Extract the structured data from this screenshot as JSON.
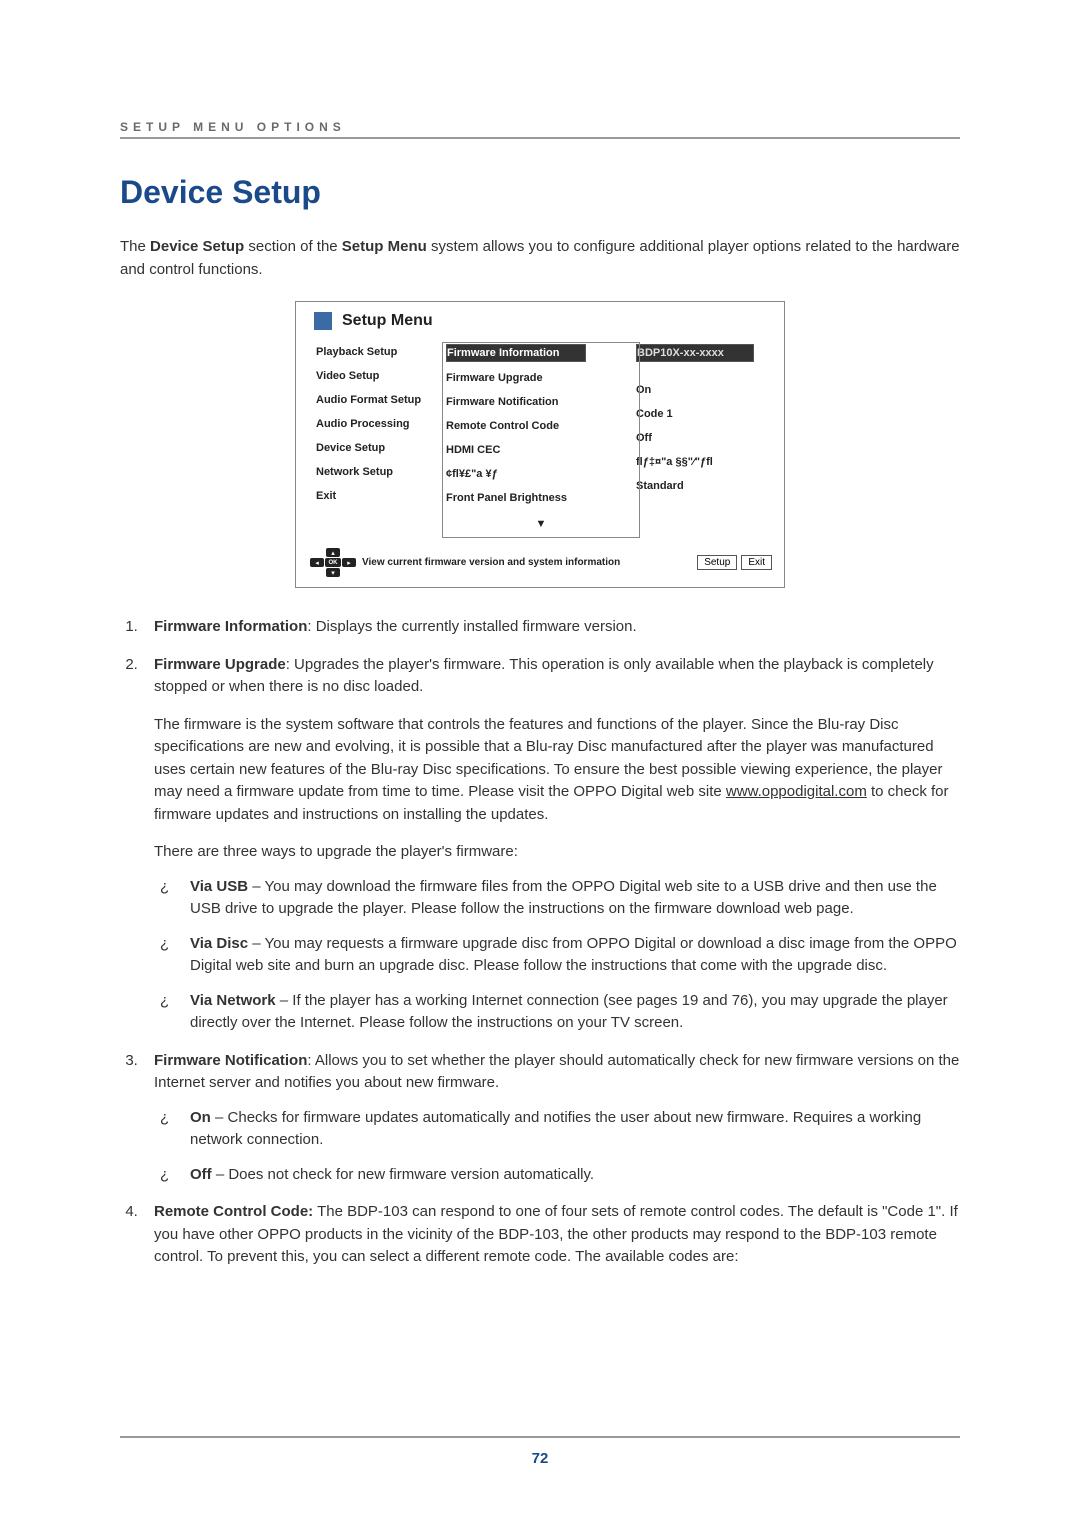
{
  "header": {
    "section_label": "SETUP MENU OPTIONS"
  },
  "title": "Device Setup",
  "intro": {
    "pre": "The ",
    "b1": "Device Setup",
    "mid": " section of the ",
    "b2": "Setup Menu",
    "post": " system allows you to configure additional player options related to the hardware and control functions."
  },
  "menu": {
    "title": "Setup Menu",
    "col1": [
      "Playback Setup",
      "Video Setup",
      "Audio Format Setup",
      "Audio Processing",
      "Device Setup",
      "Network Setup",
      "Exit"
    ],
    "col2": [
      "Firmware Information",
      "Firmware Upgrade",
      "Firmware Notification",
      "Remote Control Code",
      "HDMI CEC",
      "¢fl¥£\"a   ¥ƒ",
      "Front Panel Brightness"
    ],
    "col3": [
      "BDP10X-xx-xxxx",
      "",
      "On",
      "Code 1",
      "Off",
      "flƒ‡¤\"a §§\"⁄\"ƒfl",
      "Standard"
    ],
    "help": "View current firmware version and system information",
    "btn_setup": "Setup",
    "btn_exit": "Exit",
    "chevron": "▼"
  },
  "item1": {
    "b": "Firmware Information",
    "t": ": Displays the currently installed firmware version."
  },
  "item2": {
    "b": "Firmware Upgrade",
    "t": ":  Upgrades the player's firmware. This operation is only available when the playback is completely stopped or when there is no disc loaded.",
    "p2_pre": "The firmware is the system software that controls the features and functions of the player. Since the Blu-ray Disc specifications are new and evolving, it is possible that a Blu-ray Disc manufactured after the player was manufactured uses certain new features of the Blu-ray Disc specifications. To ensure the best possible viewing experience, the player may need a firmware update from time to time. Please visit the OPPO Digital web site ",
    "link": "www.oppodigital.com",
    "p2_post": " to check for firmware updates and instructions on installing the updates.",
    "p3": "There are three ways to upgrade the player's firmware:",
    "sub": [
      {
        "b": "Via USB",
        "t": " – You may download the firmware files from the OPPO Digital web site to a USB drive and then use the USB drive to upgrade the player. Please follow the instructions on the firmware download web page."
      },
      {
        "b": "Via Disc",
        "t": " – You may requests a firmware upgrade disc from OPPO Digital or download a disc image from the OPPO Digital web site and burn an upgrade disc. Please follow the instructions that come with the upgrade disc."
      },
      {
        "b": "Via Network",
        "t": " – If the player has a working Internet connection (see pages 19 and 76), you may upgrade the player directly over the Internet. Please follow the instructions on your TV screen."
      }
    ]
  },
  "item3": {
    "b": "Firmware Notification",
    "t": ": Allows you to set whether the player should automatically check for new firmware versions on the Internet server and notifies you about new firmware.",
    "sub": [
      {
        "b": "On",
        "t": " – Checks for firmware updates automatically and notifies the user about new firmware. Requires a working network connection."
      },
      {
        "b": "Off",
        "t": " – Does not check for new firmware version automatically."
      }
    ]
  },
  "item4": {
    "b": "Remote Control Code:",
    "t": " The BDP-103 can respond to one of four sets of remote control codes.  The default is \"Code 1\". If you have other OPPO products in the vicinity of the BDP-103, the other products may respond to the BDP-103 remote control. To prevent this, you can select a different remote code. The available codes are:"
  },
  "bullet_char": "¿",
  "pagenum": "72"
}
